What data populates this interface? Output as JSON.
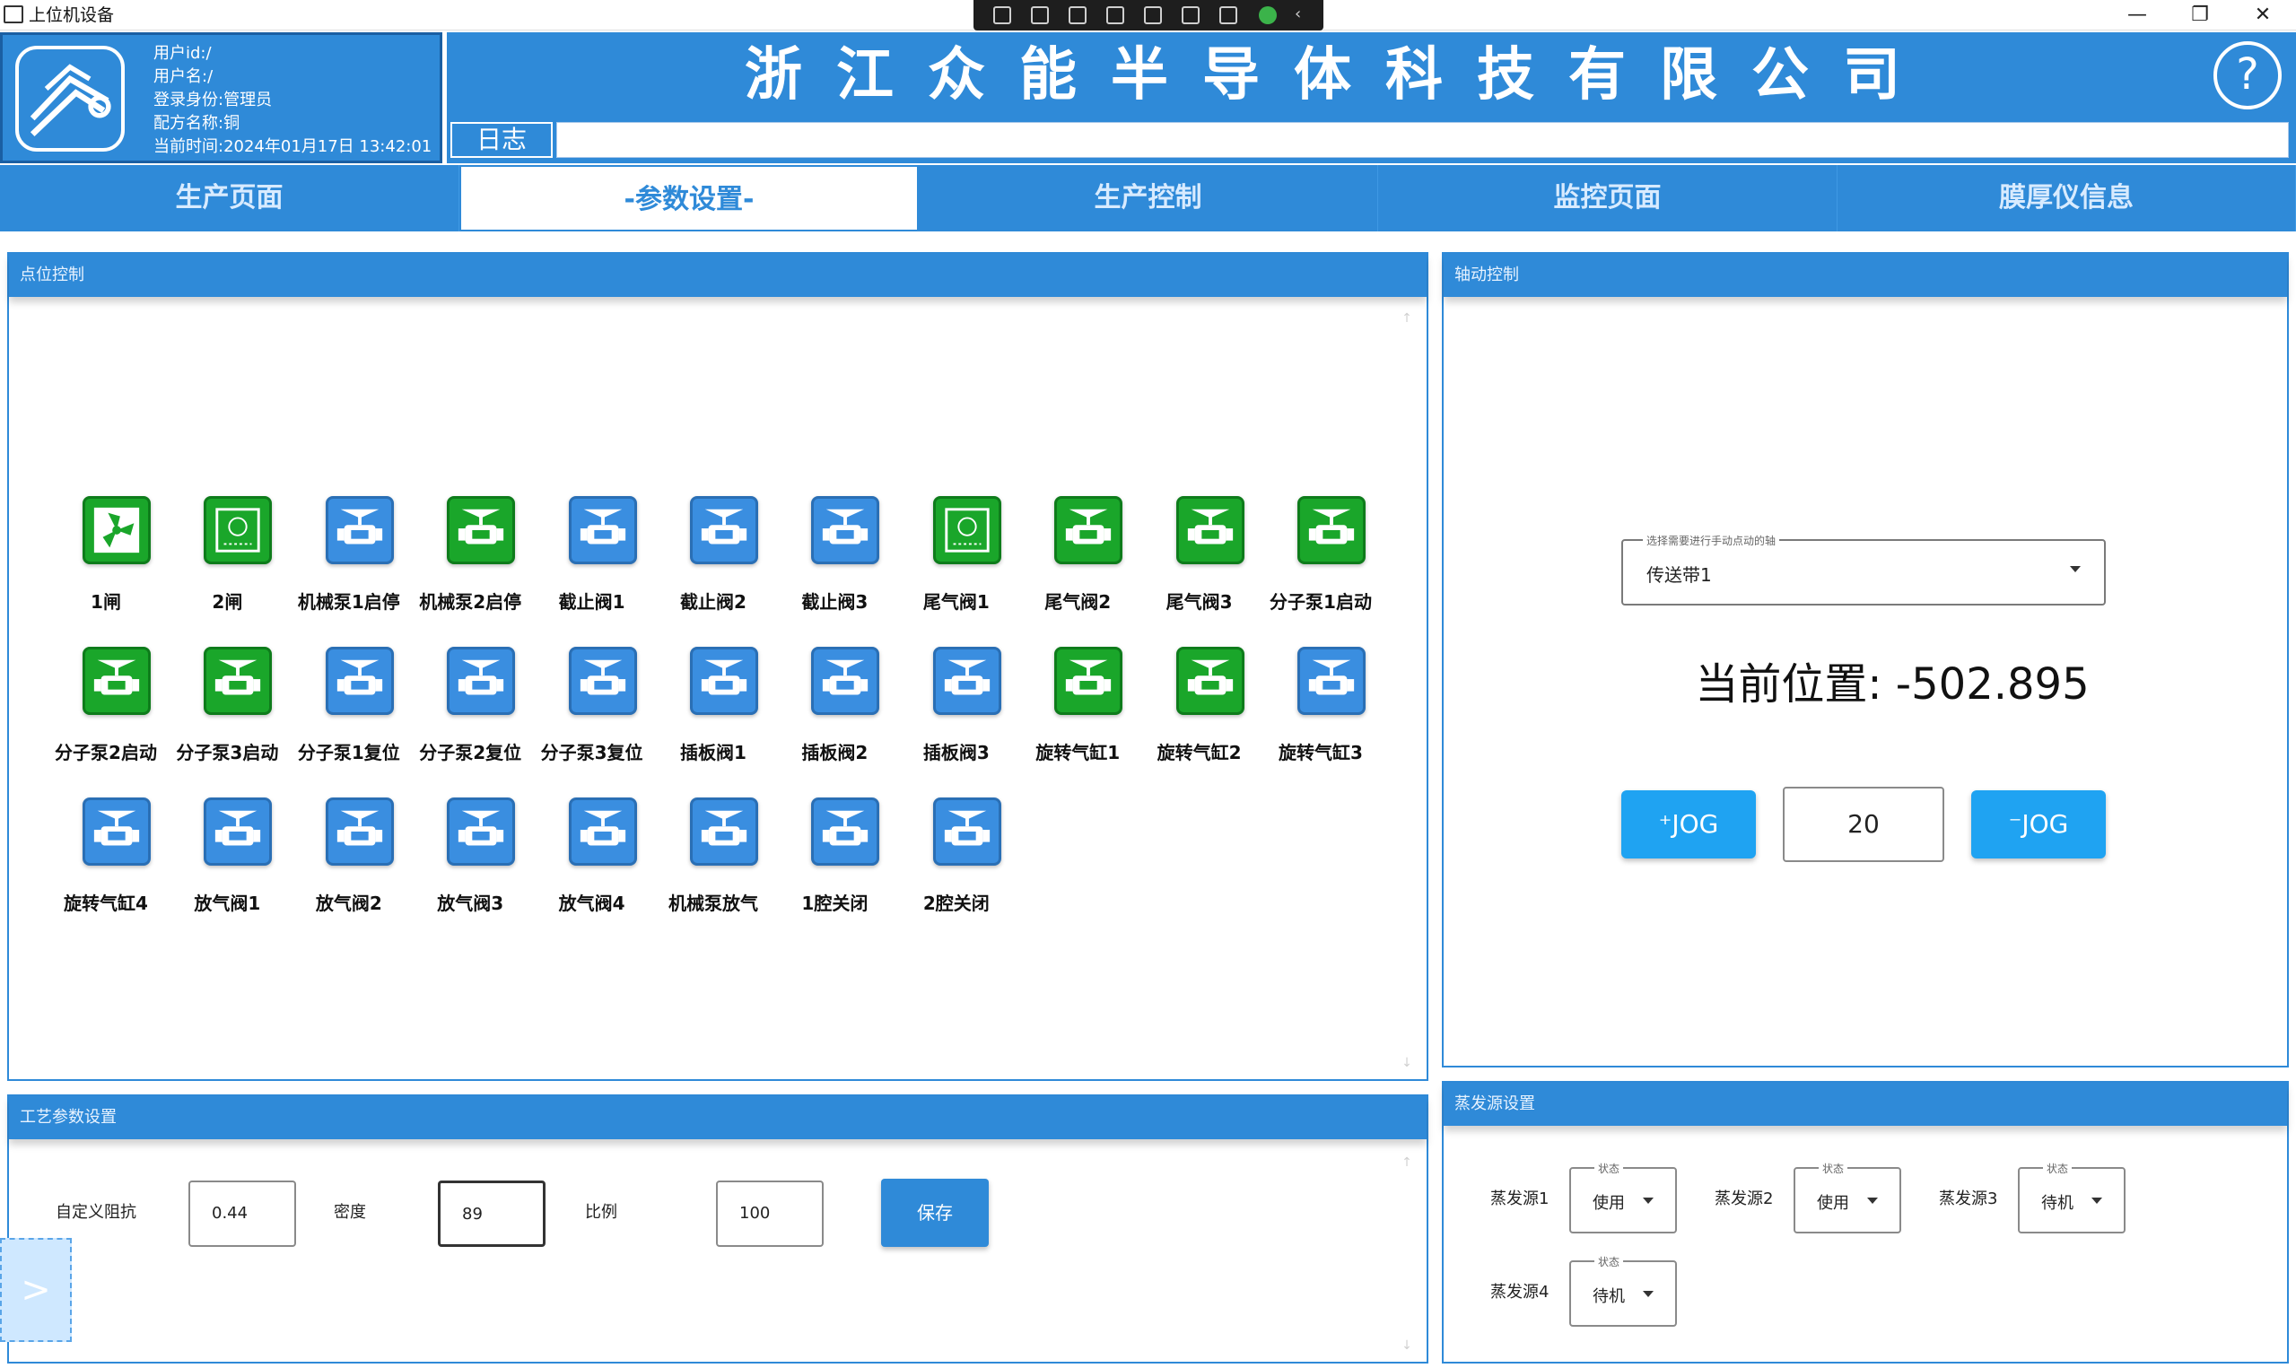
{
  "window": {
    "title": "上位机设备",
    "minimize": "—",
    "restore": "❐",
    "close": "✕"
  },
  "header": {
    "user_id": "用户id:/",
    "user_name": "用户名:/",
    "login_role": "登录身份:管理员",
    "recipe": "配方名称:铜",
    "current_time": "当前时间:2024年01月17日 13:42:01",
    "company": "浙江众能半导体科技有限公司",
    "help": "?",
    "log_label": "日志",
    "log_value": ""
  },
  "tabs": [
    {
      "label": "生产页面",
      "active": false
    },
    {
      "label": "-参数设置-",
      "active": true
    },
    {
      "label": "生产控制",
      "active": false
    },
    {
      "label": "监控页面",
      "active": false
    },
    {
      "label": "膜厚仪信息",
      "active": false
    }
  ],
  "point_control": {
    "title": "点位控制",
    "scroll_up": "↑",
    "scroll_down": "↓",
    "items": [
      {
        "label": "1闸",
        "icon": "fan-icon",
        "color": "green"
      },
      {
        "label": "2闸",
        "icon": "gauge-icon",
        "color": "green"
      },
      {
        "label": "机械泵1启停",
        "icon": "valve-icon",
        "color": "blue"
      },
      {
        "label": "机械泵2启停",
        "icon": "valve-icon",
        "color": "green"
      },
      {
        "label": "截止阀1",
        "icon": "valve-icon",
        "color": "blue"
      },
      {
        "label": "截止阀2",
        "icon": "valve-icon",
        "color": "blue"
      },
      {
        "label": "截止阀3",
        "icon": "valve-icon",
        "color": "blue"
      },
      {
        "label": "尾气阀1",
        "icon": "gauge-icon",
        "color": "green"
      },
      {
        "label": "尾气阀2",
        "icon": "valve-icon",
        "color": "green"
      },
      {
        "label": "尾气阀3",
        "icon": "valve-icon",
        "color": "green"
      },
      {
        "label": "分子泵1启动",
        "icon": "valve-icon",
        "color": "green"
      },
      {
        "label": "分子泵2启动",
        "icon": "valve-icon",
        "color": "green"
      },
      {
        "label": "分子泵3启动",
        "icon": "valve-icon",
        "color": "green"
      },
      {
        "label": "分子泵1复位",
        "icon": "valve-icon",
        "color": "blue"
      },
      {
        "label": "分子泵2复位",
        "icon": "valve-icon",
        "color": "blue"
      },
      {
        "label": "分子泵3复位",
        "icon": "valve-icon",
        "color": "blue"
      },
      {
        "label": "插板阀1",
        "icon": "valve-icon",
        "color": "blue"
      },
      {
        "label": "插板阀2",
        "icon": "valve-icon",
        "color": "blue"
      },
      {
        "label": "插板阀3",
        "icon": "valve-icon",
        "color": "blue"
      },
      {
        "label": "旋转气缸1",
        "icon": "valve-icon",
        "color": "green"
      },
      {
        "label": "旋转气缸2",
        "icon": "valve-icon",
        "color": "green"
      },
      {
        "label": "旋转气缸3",
        "icon": "valve-icon",
        "color": "blue"
      },
      {
        "label": "旋转气缸4",
        "icon": "valve-icon",
        "color": "blue"
      },
      {
        "label": "放气阀1",
        "icon": "valve-icon",
        "color": "blue"
      },
      {
        "label": "放气阀2",
        "icon": "valve-icon",
        "color": "blue"
      },
      {
        "label": "放气阀3",
        "icon": "valve-icon",
        "color": "blue"
      },
      {
        "label": "放气阀4",
        "icon": "valve-icon",
        "color": "blue"
      },
      {
        "label": "机械泵放气",
        "icon": "valve-icon",
        "color": "blue"
      },
      {
        "label": "1腔关闭",
        "icon": "valve-icon",
        "color": "blue"
      },
      {
        "label": "2腔关闭",
        "icon": "valve-icon",
        "color": "blue"
      }
    ]
  },
  "axis_control": {
    "title": "轴动控制",
    "select_label": "选择需要进行手动点动的轴",
    "select_value": "传送带1",
    "position": "当前位置: -502.895",
    "jog_plus": "⁺JOG",
    "jog_minus": "⁻JOG",
    "jog_step": "20"
  },
  "process_params": {
    "title": "工艺参数设置",
    "impedance_label": "自定义阻抗",
    "impedance_value": "0.44",
    "density_label": "密度",
    "density_value": "89",
    "ratio_label": "比例",
    "ratio_value": "100",
    "save": "保存",
    "scroll_up": "↑",
    "scroll_down": "↓"
  },
  "evaporation": {
    "title": "蒸发源设置",
    "status_label": "状态",
    "sources": [
      {
        "label": "蒸发源1",
        "value": "使用"
      },
      {
        "label": "蒸发源2",
        "value": "使用"
      },
      {
        "label": "蒸发源3",
        "value": "待机"
      },
      {
        "label": "蒸发源4",
        "value": "待机"
      }
    ]
  },
  "side_toggle": ">",
  "colors": {
    "primary": "#2f8ad8",
    "jog": "#1fa3f2",
    "green": "#1aa62a",
    "blue": "#3a8ee0"
  }
}
